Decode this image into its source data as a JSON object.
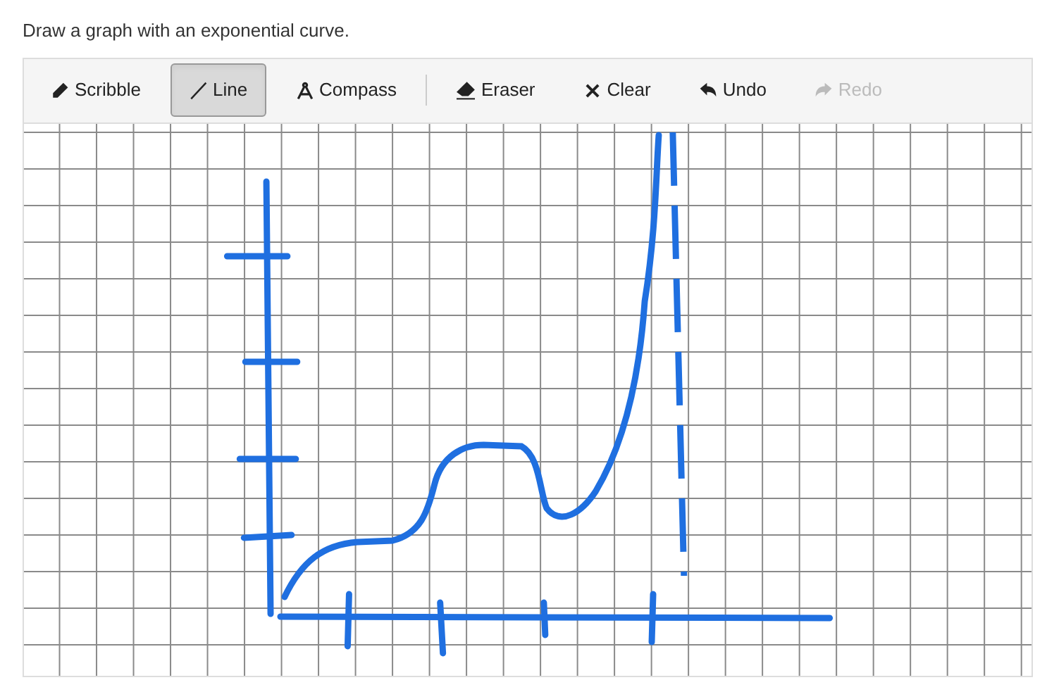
{
  "prompt": "Draw a graph with an exponential curve.",
  "tools": [
    {
      "kind": "pencil",
      "label": "Scribble",
      "selected": false,
      "disabled": false
    },
    {
      "kind": "line",
      "label": "Line",
      "selected": true,
      "disabled": false
    },
    {
      "kind": "compass",
      "label": "Compass",
      "selected": false,
      "disabled": false
    },
    {
      "kind": "eraser",
      "label": "Eraser",
      "selected": false,
      "disabled": false
    },
    {
      "kind": "clear",
      "label": "Clear",
      "selected": false,
      "disabled": false
    },
    {
      "kind": "undo",
      "label": "Undo",
      "selected": false,
      "disabled": false
    },
    {
      "kind": "redo",
      "label": "Redo",
      "selected": false,
      "disabled": true
    }
  ]
}
